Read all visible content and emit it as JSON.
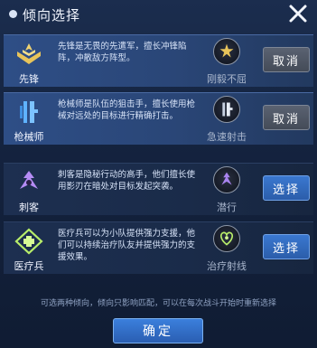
{
  "dialog": {
    "title": "倾向选择"
  },
  "roles": [
    {
      "name": "先锋",
      "description": "先锋是无畏的先遣军，擅长冲锋陷阵，冲散敌方阵型。",
      "trait": "刚毅不屈",
      "action": "取消",
      "selected": true
    },
    {
      "name": "枪械师",
      "description": "枪械师是队伍的狙击手，擅长使用枪械对远处的目标进行精确打击。",
      "trait": "急速射击",
      "action": "取消",
      "selected": true
    },
    {
      "name": "刺客",
      "description": "刺客是隐秘行动的高手，他们擅长使用影刃在暗处对目标发起突袭。",
      "trait": "潜行",
      "action": "选择",
      "selected": false
    },
    {
      "name": "医疗兵",
      "description": "医疗兵可以为小队提供强力支援，他们可以持续治疗队友并提供强力的支援效果。",
      "trait": "治疗射线",
      "action": "选择",
      "selected": false
    }
  ],
  "footer": {
    "note": "可选两种倾向，倾向只影响匹配，可以在每次战斗开始时重新选择",
    "confirm_label": "确定"
  },
  "colors": {
    "gold_icon": "#e8c45a",
    "blue_icon": "#5fb2ff",
    "purple_icon": "#b58cf5",
    "green_icon": "#b8ee6a",
    "select_button": "#3a78d0",
    "cancel_button": "#5a6272"
  }
}
